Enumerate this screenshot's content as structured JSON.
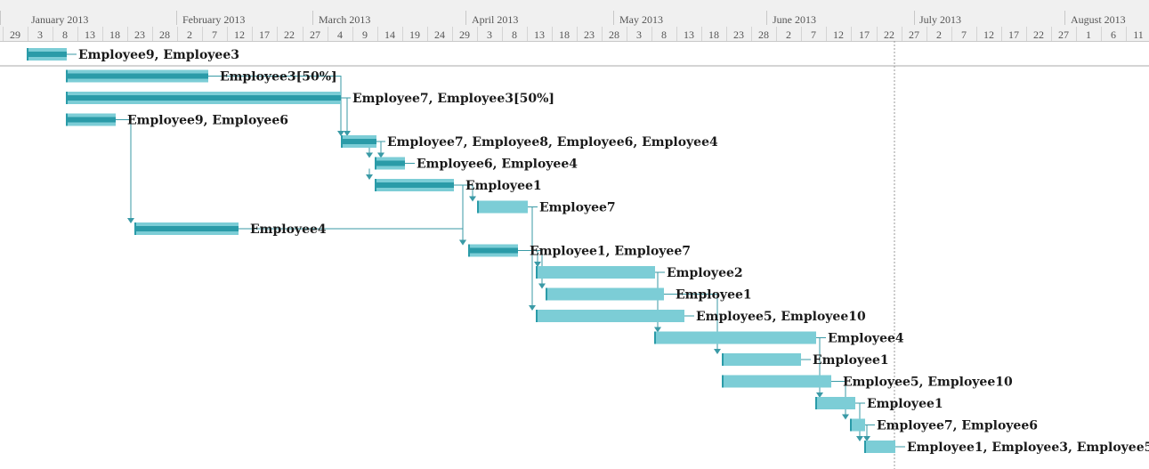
{
  "timeline": {
    "months": [
      "January 2013",
      "February 2013",
      "March 2013",
      "April 2013",
      "May 2013",
      "June 2013",
      "July 2013",
      "August 2013"
    ],
    "days": [
      "29",
      "3",
      "8",
      "13",
      "18",
      "23",
      "28",
      "2",
      "7",
      "12",
      "17",
      "22",
      "27",
      "4",
      "9",
      "14",
      "19",
      "24",
      "29",
      "3",
      "8",
      "13",
      "18",
      "23",
      "28",
      "3",
      "8",
      "13",
      "18",
      "23",
      "28",
      "2",
      "7",
      "12",
      "17",
      "22",
      "27",
      "2",
      "7",
      "12",
      "17",
      "22",
      "27",
      "1",
      "6",
      "11"
    ]
  },
  "colors": {
    "bar": "#7ccdd6",
    "progress": "#2a9ba8",
    "connector": "#3a9aa6",
    "today_line": "#999999"
  },
  "tasks": [
    {
      "resources": "Employee9, Employee3"
    },
    {
      "resources": "Employee3[50%]"
    },
    {
      "resources": "Employee7, Employee3[50%]"
    },
    {
      "resources": "Employee9, Employee6"
    },
    {
      "resources": "Employee7, Employee8, Employee6, Employee4"
    },
    {
      "resources": "Employee6, Employee4"
    },
    {
      "resources": "Employee1"
    },
    {
      "resources": "Employee7"
    },
    {
      "resources": "Employee4"
    },
    {
      "resources": "Employee1, Employee7"
    },
    {
      "resources": "Employee2"
    },
    {
      "resources": "Employee1"
    },
    {
      "resources": "Employee5, Employee10"
    },
    {
      "resources": "Employee4"
    },
    {
      "resources": "Employee1"
    },
    {
      "resources": "Employee5, Employee10"
    },
    {
      "resources": "Employee1"
    },
    {
      "resources": "Employee7, Employee6"
    },
    {
      "resources": "Employee1, Employee3, Employee5"
    }
  ]
}
